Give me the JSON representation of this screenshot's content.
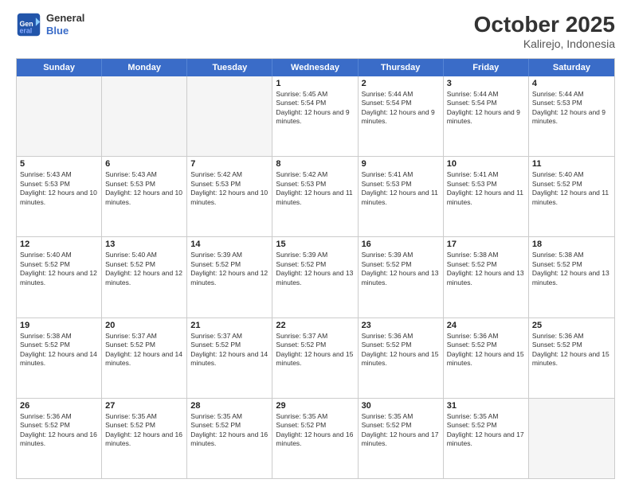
{
  "header": {
    "logo_line1": "General",
    "logo_line2": "Blue",
    "month": "October 2025",
    "location": "Kalirejo, Indonesia"
  },
  "weekdays": [
    "Sunday",
    "Monday",
    "Tuesday",
    "Wednesday",
    "Thursday",
    "Friday",
    "Saturday"
  ],
  "rows": [
    [
      {
        "day": "",
        "text": ""
      },
      {
        "day": "",
        "text": ""
      },
      {
        "day": "",
        "text": ""
      },
      {
        "day": "1",
        "text": "Sunrise: 5:45 AM\nSunset: 5:54 PM\nDaylight: 12 hours and 9 minutes."
      },
      {
        "day": "2",
        "text": "Sunrise: 5:44 AM\nSunset: 5:54 PM\nDaylight: 12 hours and 9 minutes."
      },
      {
        "day": "3",
        "text": "Sunrise: 5:44 AM\nSunset: 5:54 PM\nDaylight: 12 hours and 9 minutes."
      },
      {
        "day": "4",
        "text": "Sunrise: 5:44 AM\nSunset: 5:53 PM\nDaylight: 12 hours and 9 minutes."
      }
    ],
    [
      {
        "day": "5",
        "text": "Sunrise: 5:43 AM\nSunset: 5:53 PM\nDaylight: 12 hours and 10 minutes."
      },
      {
        "day": "6",
        "text": "Sunrise: 5:43 AM\nSunset: 5:53 PM\nDaylight: 12 hours and 10 minutes."
      },
      {
        "day": "7",
        "text": "Sunrise: 5:42 AM\nSunset: 5:53 PM\nDaylight: 12 hours and 10 minutes."
      },
      {
        "day": "8",
        "text": "Sunrise: 5:42 AM\nSunset: 5:53 PM\nDaylight: 12 hours and 11 minutes."
      },
      {
        "day": "9",
        "text": "Sunrise: 5:41 AM\nSunset: 5:53 PM\nDaylight: 12 hours and 11 minutes."
      },
      {
        "day": "10",
        "text": "Sunrise: 5:41 AM\nSunset: 5:53 PM\nDaylight: 12 hours and 11 minutes."
      },
      {
        "day": "11",
        "text": "Sunrise: 5:40 AM\nSunset: 5:52 PM\nDaylight: 12 hours and 11 minutes."
      }
    ],
    [
      {
        "day": "12",
        "text": "Sunrise: 5:40 AM\nSunset: 5:52 PM\nDaylight: 12 hours and 12 minutes."
      },
      {
        "day": "13",
        "text": "Sunrise: 5:40 AM\nSunset: 5:52 PM\nDaylight: 12 hours and 12 minutes."
      },
      {
        "day": "14",
        "text": "Sunrise: 5:39 AM\nSunset: 5:52 PM\nDaylight: 12 hours and 12 minutes."
      },
      {
        "day": "15",
        "text": "Sunrise: 5:39 AM\nSunset: 5:52 PM\nDaylight: 12 hours and 13 minutes."
      },
      {
        "day": "16",
        "text": "Sunrise: 5:39 AM\nSunset: 5:52 PM\nDaylight: 12 hours and 13 minutes."
      },
      {
        "day": "17",
        "text": "Sunrise: 5:38 AM\nSunset: 5:52 PM\nDaylight: 12 hours and 13 minutes."
      },
      {
        "day": "18",
        "text": "Sunrise: 5:38 AM\nSunset: 5:52 PM\nDaylight: 12 hours and 13 minutes."
      }
    ],
    [
      {
        "day": "19",
        "text": "Sunrise: 5:38 AM\nSunset: 5:52 PM\nDaylight: 12 hours and 14 minutes."
      },
      {
        "day": "20",
        "text": "Sunrise: 5:37 AM\nSunset: 5:52 PM\nDaylight: 12 hours and 14 minutes."
      },
      {
        "day": "21",
        "text": "Sunrise: 5:37 AM\nSunset: 5:52 PM\nDaylight: 12 hours and 14 minutes."
      },
      {
        "day": "22",
        "text": "Sunrise: 5:37 AM\nSunset: 5:52 PM\nDaylight: 12 hours and 15 minutes."
      },
      {
        "day": "23",
        "text": "Sunrise: 5:36 AM\nSunset: 5:52 PM\nDaylight: 12 hours and 15 minutes."
      },
      {
        "day": "24",
        "text": "Sunrise: 5:36 AM\nSunset: 5:52 PM\nDaylight: 12 hours and 15 minutes."
      },
      {
        "day": "25",
        "text": "Sunrise: 5:36 AM\nSunset: 5:52 PM\nDaylight: 12 hours and 15 minutes."
      }
    ],
    [
      {
        "day": "26",
        "text": "Sunrise: 5:36 AM\nSunset: 5:52 PM\nDaylight: 12 hours and 16 minutes."
      },
      {
        "day": "27",
        "text": "Sunrise: 5:35 AM\nSunset: 5:52 PM\nDaylight: 12 hours and 16 minutes."
      },
      {
        "day": "28",
        "text": "Sunrise: 5:35 AM\nSunset: 5:52 PM\nDaylight: 12 hours and 16 minutes."
      },
      {
        "day": "29",
        "text": "Sunrise: 5:35 AM\nSunset: 5:52 PM\nDaylight: 12 hours and 16 minutes."
      },
      {
        "day": "30",
        "text": "Sunrise: 5:35 AM\nSunset: 5:52 PM\nDaylight: 12 hours and 17 minutes."
      },
      {
        "day": "31",
        "text": "Sunrise: 5:35 AM\nSunset: 5:52 PM\nDaylight: 12 hours and 17 minutes."
      },
      {
        "day": "",
        "text": ""
      }
    ]
  ]
}
